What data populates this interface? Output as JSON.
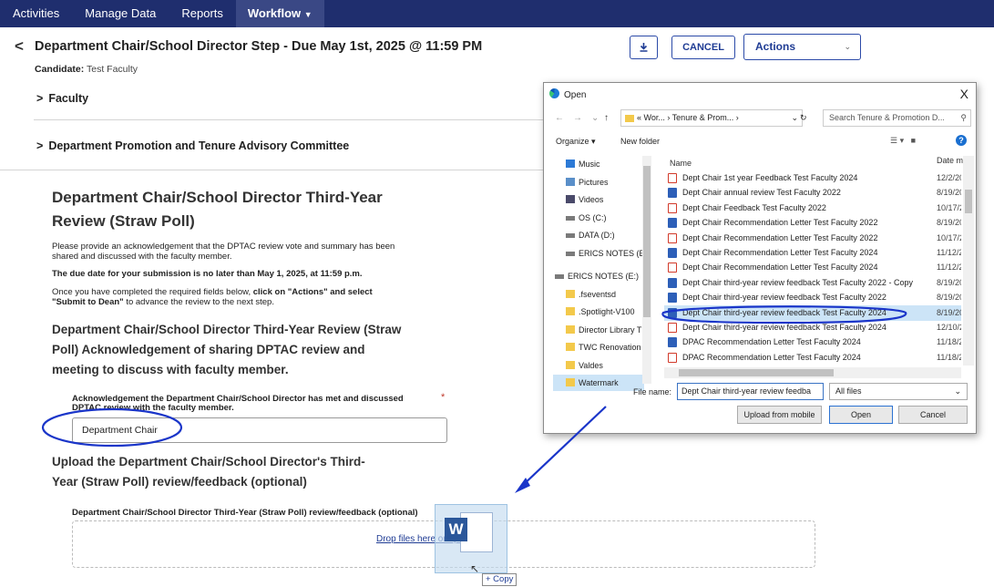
{
  "topnav": {
    "items": [
      "Activities",
      "Manage Data",
      "Reports",
      "Workflow"
    ],
    "active_item": "Workflow",
    "active_chevron": "▼"
  },
  "header": {
    "back_glyph": "<",
    "title": "Department Chair/School Director Step - Due May 1st, 2025 @ 11:59 PM",
    "candidate_label": "Candidate:",
    "candidate_value": "Test Faculty",
    "cancel_label": "CANCEL",
    "actions_label": "Actions",
    "download_icon": "download-icon"
  },
  "sections": {
    "faculty": "Faculty",
    "dptac": "Department Promotion and Tenure Advisory Committee"
  },
  "form": {
    "heading": "Department Chair/School Director Third-Year Review (Straw Poll)",
    "intro": "Please provide an acknowledgement that the DPTAC review vote and summary has been shared and discussed with the faculty member.",
    "due_note": "The due date for your submission is no later than May 1, 2025, at 11:59 p.m.",
    "completed_note_prefix": "Once you have completed the required fields below, ",
    "completed_note_bold": "click on \"Actions\" and select \"Submit to Dean\"",
    "completed_note_suffix": " to advance the review to the next step.",
    "ack_heading": "Department Chair/School Director Third-Year Review (Straw Poll) Acknowledgement of sharing DPTAC review and meeting to discuss with faculty member.",
    "ack_field_label": "Acknowledgement the Department Chair/School Director has met and discussed DPTAC review with the faculty member.",
    "required_mark": "*",
    "ack_field_value": "Department Chair",
    "upload_heading": "Upload the Department Chair/School Director's Third-Year (Straw Poll) review/feedback (optional)",
    "upload_field_label": "Department Chair/School Director Third-Year (Straw Poll) review/feedback (optional)",
    "drop_text": "Drop files here or upload"
  },
  "dialog": {
    "title": "Open",
    "close_glyph": "X",
    "address": "« Wor... › Tenure & Prom... ›",
    "search_placeholder": "Search Tenure & Promotion D...",
    "organize": "Organize ▾",
    "new_folder": "New folder",
    "col_name": "Name",
    "col_date": "Date m",
    "tree": [
      {
        "label": "Music",
        "icon": "music-icon"
      },
      {
        "label": "Pictures",
        "icon": "pictures-icon"
      },
      {
        "label": "Videos",
        "icon": "videos-icon"
      },
      {
        "label": "OS (C:)",
        "icon": "drive-icon"
      },
      {
        "label": "DATA (D:)",
        "icon": "drive-icon"
      },
      {
        "label": "ERICS NOTES (E:)",
        "icon": "drive-icon"
      },
      {
        "label": "ERICS NOTES (E:)",
        "icon": "drive-icon"
      },
      {
        "label": ".fseventsd",
        "icon": "folder-icon"
      },
      {
        "label": ".Spotlight-V100",
        "icon": "folder-icon"
      },
      {
        "label": "Director Library T",
        "icon": "folder-icon"
      },
      {
        "label": "TWC Renovation",
        "icon": "folder-icon"
      },
      {
        "label": "Valdes",
        "icon": "folder-icon"
      },
      {
        "label": "Watermark",
        "icon": "folder-icon"
      }
    ],
    "files": [
      {
        "name": "Dept Chair 1st year Feedback Test Faculty 2024",
        "date": "12/2/20",
        "type": "pdf"
      },
      {
        "name": "Dept Chair annual review Test Faculty 2022",
        "date": "8/19/20",
        "type": "doc"
      },
      {
        "name": "Dept Chair Feedback Test Faculty 2022",
        "date": "10/17/2",
        "type": "pdf"
      },
      {
        "name": "Dept Chair Recommendation Letter Test Faculty 2022",
        "date": "8/19/20",
        "type": "doc"
      },
      {
        "name": "Dept Chair Recommendation Letter Test Faculty 2022",
        "date": "10/17/2",
        "type": "pdf"
      },
      {
        "name": "Dept Chair Recommendation Letter Test Faculty 2024",
        "date": "11/12/2",
        "type": "doc"
      },
      {
        "name": "Dept Chair Recommendation Letter Test Faculty 2024",
        "date": "11/12/2",
        "type": "pdf"
      },
      {
        "name": "Dept Chair third-year review feedback Test Faculty 2022 - Copy",
        "date": "8/19/20",
        "type": "doc"
      },
      {
        "name": "Dept Chair third-year review feedback Test Faculty 2022",
        "date": "8/19/20",
        "type": "doc"
      },
      {
        "name": "Dept Chair third-year review feedback Test Faculty 2024",
        "date": "8/19/20",
        "type": "doc"
      },
      {
        "name": "Dept Chair third-year review feedback Test Faculty 2024",
        "date": "12/10/2",
        "type": "pdf"
      },
      {
        "name": "DPAC Recommendation Letter Test Faculty 2024",
        "date": "11/18/2",
        "type": "doc"
      },
      {
        "name": "DPAC Recommendation Letter Test Faculty 2024",
        "date": "11/18/2",
        "type": "pdf"
      }
    ],
    "selected_index": 9,
    "filename_label": "File name:",
    "filename_value": "Dept Chair third-year review feedba",
    "filetype": "All files",
    "upload_mobile": "Upload from mobile",
    "open_label": "Open",
    "cancel_label": "Cancel"
  },
  "drag": {
    "word_letter": "W",
    "copy_tip": "+ Copy"
  },
  "colors": {
    "nav_bg": "#1f2e6e",
    "accent": "#1f3c94",
    "annotation_blue": "#1a35c9",
    "selected_row": "#cce4f7"
  }
}
